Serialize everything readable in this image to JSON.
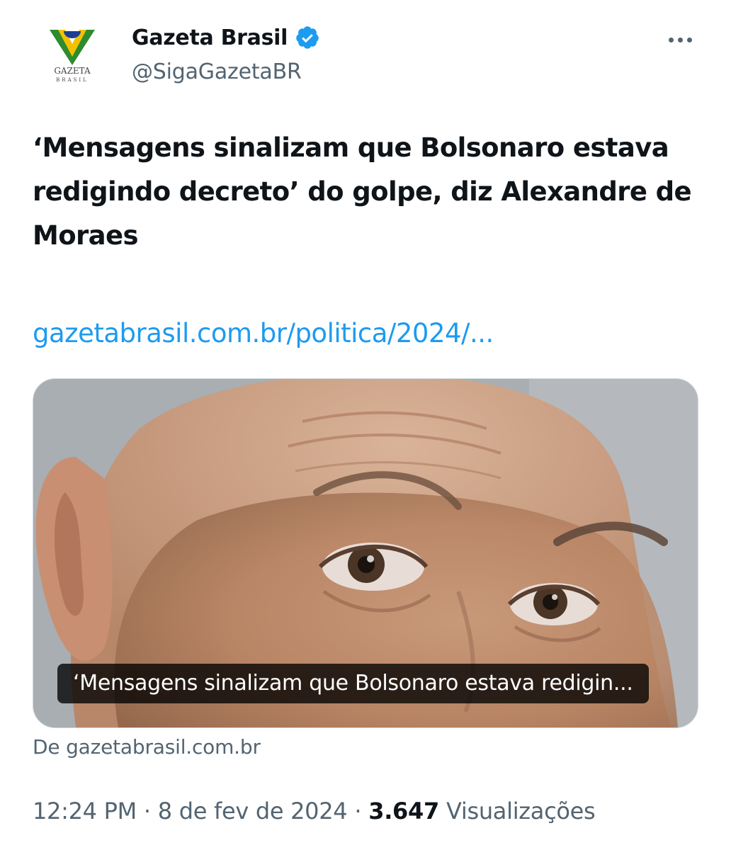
{
  "author": {
    "display_name": "Gazeta Brasil",
    "handle": "@SigaGazetaBR",
    "logo_text_top": "GAZETA",
    "logo_text_bottom": "BRASIL",
    "verified": true
  },
  "tweet": {
    "text": "‘Mensagens sinalizam que Bolsonaro estava redigindo decreto’ do golpe, diz Alexandre de Moraes",
    "link_text": "gazetabrasil.com.br/politica/2024/..."
  },
  "card": {
    "caption": "‘Mensagens sinalizam que Bolsonaro estava redigin...",
    "source": "De gazetabrasil.com.br"
  },
  "meta": {
    "time": "12:24 PM",
    "separator": "·",
    "date": "8 de fev de 2024",
    "views_count": "3.647",
    "views_label": "Visualizações"
  },
  "icons": {
    "verified": "verified-badge-icon",
    "more": "more-options-icon"
  },
  "colors": {
    "accent": "#1d9bf0",
    "text_primary": "#0f1419",
    "text_secondary": "#536471",
    "logo_green": "#2e8b2e",
    "logo_yellow": "#f2c200",
    "logo_blue": "#1c3f94"
  }
}
